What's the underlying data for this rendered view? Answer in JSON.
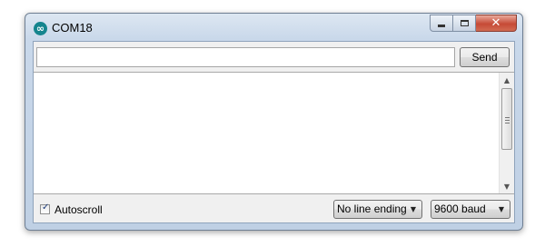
{
  "window": {
    "title": "COM18"
  },
  "icons": {
    "app": "arduino-infinity-icon",
    "minimize": "minimize-icon",
    "maximize": "maximize-icon",
    "close": "close-icon",
    "dropdown": "chevron-down-icon"
  },
  "caption": {
    "close_glyph": "✕",
    "app_glyph": "∞"
  },
  "input": {
    "value": "",
    "placeholder": ""
  },
  "send": {
    "label": "Send"
  },
  "output": {
    "text": ""
  },
  "footer": {
    "autoscroll": {
      "label": "Autoscroll",
      "checked": true,
      "check_glyph": "✓"
    },
    "line_ending": {
      "selected": "No line ending"
    },
    "baud": {
      "selected": "9600 baud"
    }
  },
  "scroll": {
    "up_glyph": "▲",
    "down_glyph": "▼"
  },
  "colors": {
    "icon_teal": "#15858e",
    "frame": "#c9d8ea",
    "close_red": "#c64a36"
  }
}
